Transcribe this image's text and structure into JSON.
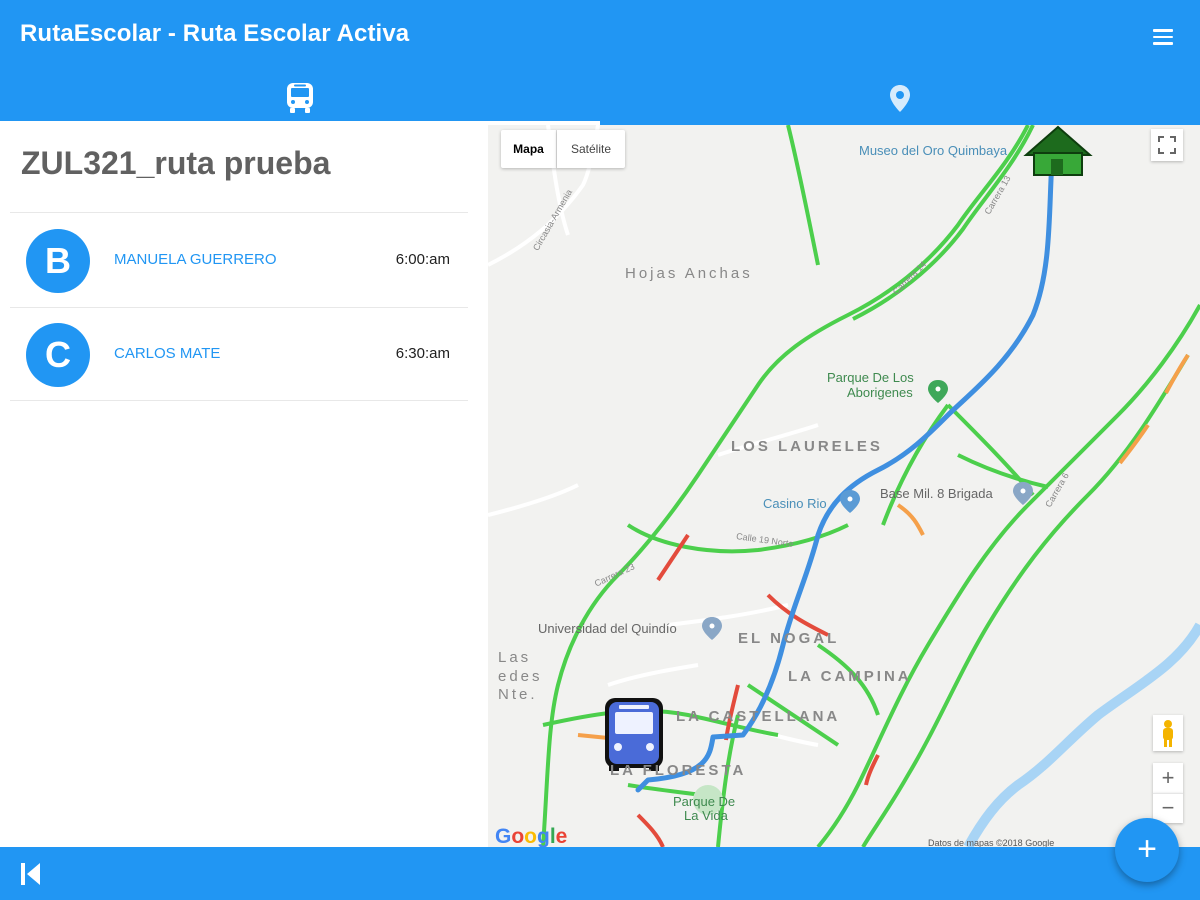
{
  "header": {
    "title": "RutaEscolar - Ruta Escolar Activa",
    "menu_icon": "hamburger-menu-icon"
  },
  "tabs": [
    {
      "icon": "bus-icon",
      "selected": true
    },
    {
      "icon": "map-pin-icon",
      "selected": false
    }
  ],
  "route": {
    "name": "ZUL321_ruta prueba",
    "students": [
      {
        "initial": "B",
        "name": "MANUELA GUERRERO",
        "time": "6:00:am"
      },
      {
        "initial": "C",
        "name": "CARLOS MATE",
        "time": "6:30:am"
      }
    ]
  },
  "map": {
    "map_type_buttons": {
      "map": "Mapa",
      "satellite": "Satélite"
    },
    "selected_map_type": "map",
    "places": {
      "museo": "Museo del Oro Quimbaya",
      "parque_aborigenes_1": "Parque De Los",
      "parque_aborigenes_2": "Aborigenes",
      "casino": "Casino Rio",
      "base_militar": "Base Mil. 8 Brigada",
      "universidad": "Universidad del Quindío",
      "parque_vida_1": "Parque De",
      "parque_vida_2": "La Vida"
    },
    "neighborhoods": {
      "hojas_anchas": "Hojas Anchas",
      "laureles": "LOS LAURELES",
      "nogal": "EL NOGAL",
      "campina": "LA CAMPINA",
      "castellana": "LA CASTELLANA",
      "floresta": "LA FLORESTA",
      "las": "Las",
      "redes": "edes",
      "nte": "Nte."
    },
    "streets": {
      "circasia": "Circasia-Armenia",
      "carrera13": "Carrera 13",
      "carrera14": "Carrera 14",
      "carrera6": "Carrera 6",
      "calle19": "Calle 19 Norte",
      "carrera23": "Carrera 23"
    },
    "attribution": "Datos de mapas ©2018 Google",
    "google_logo": "Google",
    "zoom_in": "+",
    "zoom_out": "−",
    "colors": {
      "route": "#3f8fe0",
      "traffic_green": "#4ccf4c",
      "traffic_orange": "#f5a04a",
      "traffic_red": "#e34b3c",
      "river": "#a8d4f5"
    }
  },
  "bottom_bar": {
    "back_icon": "skip-back-icon",
    "fab_label": "+"
  }
}
